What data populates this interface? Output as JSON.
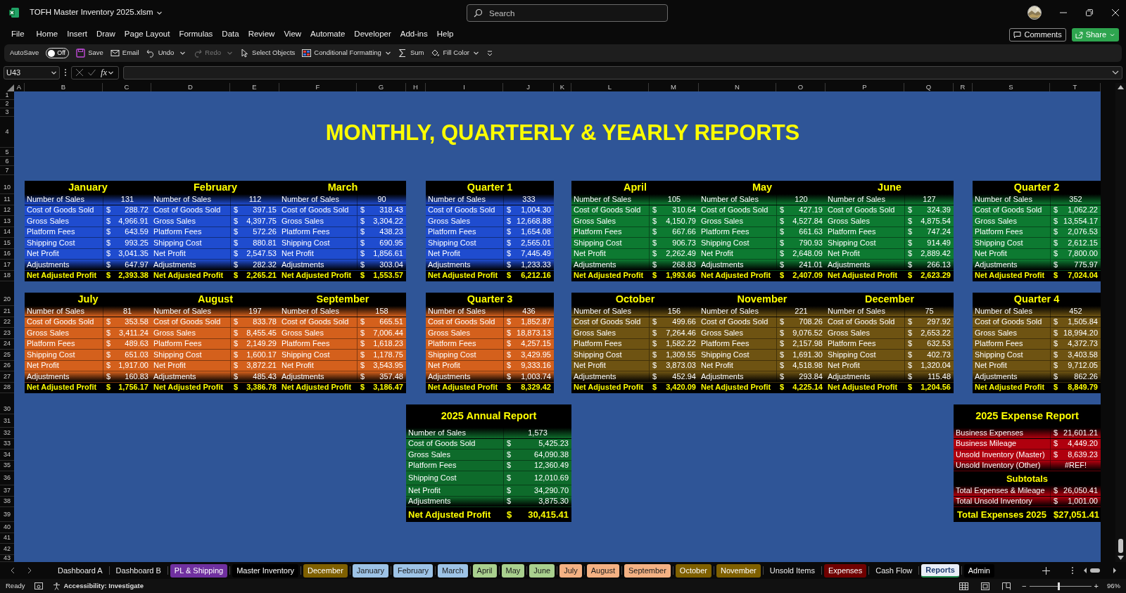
{
  "window": {
    "file_name": "TOFH Master Inventory 2025.xlsm"
  },
  "search": {
    "placeholder": "Search"
  },
  "menu": [
    "File",
    "Home",
    "Insert",
    "Draw",
    "Page Layout",
    "Formulas",
    "Data",
    "Review",
    "View",
    "Automate",
    "Developer",
    "Add-ins",
    "Help"
  ],
  "comments_button": "Comments",
  "share_button": "Share",
  "toolbar": {
    "autosave": {
      "label": "AutoSave",
      "state_text": "Off",
      "on": false
    },
    "buttons": [
      {
        "label": "Save",
        "disabled": false,
        "menu": false
      },
      {
        "label": "Email",
        "disabled": false,
        "menu": false
      },
      {
        "label": "Undo",
        "disabled": false,
        "menu": true
      },
      {
        "label": "Redo",
        "disabled": true,
        "menu": true
      },
      {
        "label": "Select Objects",
        "disabled": false,
        "menu": false
      },
      {
        "label": "Conditional Formatting",
        "disabled": false,
        "menu": true
      },
      {
        "label": "Sum",
        "disabled": false,
        "menu": false
      },
      {
        "label": "Fill Color",
        "disabled": false,
        "menu": true
      }
    ]
  },
  "formula_bar": {
    "name_box": "U43",
    "function_label": "fx"
  },
  "column_headers": [
    "A",
    "B",
    "C",
    "D",
    "E",
    "F",
    "G",
    "H",
    "I",
    "J",
    "K",
    "L",
    "M",
    "N",
    "O",
    "P",
    "Q",
    "R",
    "S",
    "T"
  ],
  "row_headers": [
    "1",
    "2",
    "3",
    "4",
    "5",
    "6",
    "7",
    "10",
    "11",
    "12",
    "13",
    "14",
    "15",
    "16",
    "17",
    "18",
    "20",
    "21",
    "22",
    "23",
    "24",
    "25",
    "26",
    "27",
    "28",
    "30",
    "31",
    "32",
    "33",
    "34",
    "35",
    "36",
    "37",
    "38",
    "39",
    "40",
    "41",
    "42",
    "43"
  ],
  "report_title": "MONTHLY, QUARTERLY & YEARLY REPORTS",
  "sections": [
    {
      "color": "#1f4ccf",
      "months": [
        {
          "name": "January",
          "rows": [
            {
              "label": "Number of Sales",
              "value": "131"
            },
            {
              "label": "Cost of Goods Sold",
              "unit": "$",
              "value": "288.72"
            },
            {
              "label": "Gross Sales",
              "unit": "$",
              "value": "4,966.91"
            },
            {
              "label": "Platform Fees",
              "unit": "$",
              "value": "643.59"
            },
            {
              "label": "Shipping Cost",
              "unit": "$",
              "value": "993.25"
            },
            {
              "label": "Net Profit",
              "unit": "$",
              "value": "3,041.35"
            },
            {
              "label": "Adjustments",
              "unit": "$",
              "value": "647.97"
            },
            {
              "label": "Net Adjusted Profit",
              "unit": "$",
              "value": "2,393.38"
            }
          ]
        },
        {
          "name": "February",
          "rows": [
            {
              "label": "Number of Sales",
              "value": "112"
            },
            {
              "label": "Cost of Goods Sold",
              "unit": "$",
              "value": "397.15"
            },
            {
              "label": "Gross Sales",
              "unit": "$",
              "value": "4,397.75"
            },
            {
              "label": "Platform Fees",
              "unit": "$",
              "value": "572.26"
            },
            {
              "label": "Shipping Cost",
              "unit": "$",
              "value": "880.81"
            },
            {
              "label": "Net Profit",
              "unit": "$",
              "value": "2,547.53"
            },
            {
              "label": "Adjustments",
              "unit": "$",
              "value": "282.32"
            },
            {
              "label": "Net Adjusted Profit",
              "unit": "$",
              "value": "2,265.21"
            }
          ]
        },
        {
          "name": "March",
          "rows": [
            {
              "label": "Number of Sales",
              "value": "90"
            },
            {
              "label": "Cost of Goods Sold",
              "unit": "$",
              "value": "318.43"
            },
            {
              "label": "Gross Sales",
              "unit": "$",
              "value": "3,304.22"
            },
            {
              "label": "Platform Fees",
              "unit": "$",
              "value": "438.23"
            },
            {
              "label": "Shipping Cost",
              "unit": "$",
              "value": "690.95"
            },
            {
              "label": "Net Profit",
              "unit": "$",
              "value": "1,856.61"
            },
            {
              "label": "Adjustments",
              "unit": "$",
              "value": "303.04"
            },
            {
              "label": "Net Adjusted Profit",
              "unit": "$",
              "value": "1,553.57"
            }
          ]
        }
      ],
      "quarter": {
        "name": "Quarter 1",
        "rows": [
          {
            "label": "Number of Sales",
            "value": "333"
          },
          {
            "label": "Cost of Goods Sold",
            "unit": "$",
            "value": "1,004.30"
          },
          {
            "label": "Gross Sales",
            "unit": "$",
            "value": "12,668.88"
          },
          {
            "label": "Platform Fees",
            "unit": "$",
            "value": "1,654.08"
          },
          {
            "label": "Shipping Cost",
            "unit": "$",
            "value": "2,565.01"
          },
          {
            "label": "Net Profit",
            "unit": "$",
            "value": "7,445.49"
          },
          {
            "label": "Adjustments",
            "unit": "$",
            "value": "1,233.33"
          },
          {
            "label": "Net Adjusted Profit",
            "unit": "$",
            "value": "6,212.16"
          }
        ]
      }
    },
    {
      "color": "#0d7a31",
      "months": [
        {
          "name": "April",
          "rows": [
            {
              "label": "Number of Sales",
              "value": "105"
            },
            {
              "label": "Cost of Goods Sold",
              "unit": "$",
              "value": "310.64"
            },
            {
              "label": "Gross Sales",
              "unit": "$",
              "value": "4,150.79"
            },
            {
              "label": "Platform Fees",
              "unit": "$",
              "value": "667.66"
            },
            {
              "label": "Shipping Cost",
              "unit": "$",
              "value": "906.73"
            },
            {
              "label": "Net Profit",
              "unit": "$",
              "value": "2,262.49"
            },
            {
              "label": "Adjustments",
              "unit": "$",
              "value": "268.83"
            },
            {
              "label": "Net Adjusted Profit",
              "unit": "$",
              "value": "1,993.66"
            }
          ]
        },
        {
          "name": "May",
          "rows": [
            {
              "label": "Number of Sales",
              "value": "120"
            },
            {
              "label": "Cost of Goods Sold",
              "unit": "$",
              "value": "427.19"
            },
            {
              "label": "Gross Sales",
              "unit": "$",
              "value": "4,527.84"
            },
            {
              "label": "Platform Fees",
              "unit": "$",
              "value": "661.63"
            },
            {
              "label": "Shipping Cost",
              "unit": "$",
              "value": "790.93"
            },
            {
              "label": "Net Profit",
              "unit": "$",
              "value": "2,648.09"
            },
            {
              "label": "Adjustments",
              "unit": "$",
              "value": "241.01"
            },
            {
              "label": "Net Adjusted Profit",
              "unit": "$",
              "value": "2,407.09"
            }
          ]
        },
        {
          "name": "June",
          "rows": [
            {
              "label": "Number of Sales",
              "value": "127"
            },
            {
              "label": "Cost of Goods Sold",
              "unit": "$",
              "value": "324.39"
            },
            {
              "label": "Gross Sales",
              "unit": "$",
              "value": "4,875.54"
            },
            {
              "label": "Platform Fees",
              "unit": "$",
              "value": "747.24"
            },
            {
              "label": "Shipping Cost",
              "unit": "$",
              "value": "914.49"
            },
            {
              "label": "Net Profit",
              "unit": "$",
              "value": "2,889.42"
            },
            {
              "label": "Adjustments",
              "unit": "$",
              "value": "266.13"
            },
            {
              "label": "Net Adjusted Profit",
              "unit": "$",
              "value": "2,623.29"
            }
          ]
        }
      ],
      "quarter": {
        "name": "Quarter 2",
        "rows": [
          {
            "label": "Number of Sales",
            "value": "352"
          },
          {
            "label": "Cost of Goods Sold",
            "unit": "$",
            "value": "1,062.22"
          },
          {
            "label": "Gross Sales",
            "unit": "$",
            "value": "13,554.17"
          },
          {
            "label": "Platform Fees",
            "unit": "$",
            "value": "2,076.53"
          },
          {
            "label": "Shipping Cost",
            "unit": "$",
            "value": "2,612.15"
          },
          {
            "label": "Net Profit",
            "unit": "$",
            "value": "7,800.00"
          },
          {
            "label": "Adjustments",
            "unit": "$",
            "value": "775.97"
          },
          {
            "label": "Net Adjusted Profit",
            "unit": "$",
            "value": "7,024.04"
          }
        ]
      }
    },
    {
      "color": "#d4601c",
      "months": [
        {
          "name": "July",
          "rows": [
            {
              "label": "Number of Sales",
              "value": "81"
            },
            {
              "label": "Cost of Goods Sold",
              "unit": "$",
              "value": "353.58"
            },
            {
              "label": "Gross Sales",
              "unit": "$",
              "value": "3,411.24"
            },
            {
              "label": "Platform Fees",
              "unit": "$",
              "value": "489.63"
            },
            {
              "label": "Shipping Cost",
              "unit": "$",
              "value": "651.03"
            },
            {
              "label": "Net Profit",
              "unit": "$",
              "value": "1,917.00"
            },
            {
              "label": "Adjustments",
              "unit": "$",
              "value": "160.83"
            },
            {
              "label": "Net Adjusted Profit",
              "unit": "$",
              "value": "1,756.17"
            }
          ]
        },
        {
          "name": "August",
          "rows": [
            {
              "label": "Number of Sales",
              "value": "197"
            },
            {
              "label": "Cost of Goods Sold",
              "unit": "$",
              "value": "833.78"
            },
            {
              "label": "Gross Sales",
              "unit": "$",
              "value": "8,455.45"
            },
            {
              "label": "Platform Fees",
              "unit": "$",
              "value": "2,149.29"
            },
            {
              "label": "Shipping Cost",
              "unit": "$",
              "value": "1,600.17"
            },
            {
              "label": "Net Profit",
              "unit": "$",
              "value": "3,872.21"
            },
            {
              "label": "Adjustments",
              "unit": "$",
              "value": "485.43"
            },
            {
              "label": "Net Adjusted Profit",
              "unit": "$",
              "value": "3,386.78"
            }
          ]
        },
        {
          "name": "September",
          "rows": [
            {
              "label": "Number of Sales",
              "value": "158"
            },
            {
              "label": "Cost of Goods Sold",
              "unit": "$",
              "value": "665.51"
            },
            {
              "label": "Gross Sales",
              "unit": "$",
              "value": "7,006.44"
            },
            {
              "label": "Platform Fees",
              "unit": "$",
              "value": "1,618.23"
            },
            {
              "label": "Shipping Cost",
              "unit": "$",
              "value": "1,178.75"
            },
            {
              "label": "Net Profit",
              "unit": "$",
              "value": "3,543.95"
            },
            {
              "label": "Adjustments",
              "unit": "$",
              "value": "357.48"
            },
            {
              "label": "Net Adjusted Profit",
              "unit": "$",
              "value": "3,186.47"
            }
          ]
        }
      ],
      "quarter": {
        "name": "Quarter 3",
        "rows": [
          {
            "label": "Number of Sales",
            "value": "436"
          },
          {
            "label": "Cost of Goods Sold",
            "unit": "$",
            "value": "1,852.87"
          },
          {
            "label": "Gross Sales",
            "unit": "$",
            "value": "18,873.13"
          },
          {
            "label": "Platform Fees",
            "unit": "$",
            "value": "4,257.15"
          },
          {
            "label": "Shipping Cost",
            "unit": "$",
            "value": "3,429.95"
          },
          {
            "label": "Net Profit",
            "unit": "$",
            "value": "9,333.16"
          },
          {
            "label": "Adjustments",
            "unit": "$",
            "value": "1,003.74"
          },
          {
            "label": "Net Adjusted Profit",
            "unit": "$",
            "value": "8,329.42"
          }
        ]
      }
    },
    {
      "color": "#6e5312",
      "months": [
        {
          "name": "October",
          "rows": [
            {
              "label": "Number of Sales",
              "value": "156"
            },
            {
              "label": "Cost of Goods Sold",
              "unit": "$",
              "value": "499.66"
            },
            {
              "label": "Gross Sales",
              "unit": "$",
              "value": "7,264.46"
            },
            {
              "label": "Platform Fees",
              "unit": "$",
              "value": "1,582.22"
            },
            {
              "label": "Shipping Cost",
              "unit": "$",
              "value": "1,309.55"
            },
            {
              "label": "Net Profit",
              "unit": "$",
              "value": "3,873.03"
            },
            {
              "label": "Adjustments",
              "unit": "$",
              "value": "452.94"
            },
            {
              "label": "Net Adjusted Profit",
              "unit": "$",
              "value": "3,420.09"
            }
          ]
        },
        {
          "name": "November",
          "rows": [
            {
              "label": "Number of Sales",
              "value": "221"
            },
            {
              "label": "Cost of Goods Sold",
              "unit": "$",
              "value": "708.26"
            },
            {
              "label": "Gross Sales",
              "unit": "$",
              "value": "9,076.52"
            },
            {
              "label": "Platform Fees",
              "unit": "$",
              "value": "2,157.98"
            },
            {
              "label": "Shipping Cost",
              "unit": "$",
              "value": "1,691.30"
            },
            {
              "label": "Net Profit",
              "unit": "$",
              "value": "4,518.98"
            },
            {
              "label": "Adjustments",
              "unit": "$",
              "value": "293.84"
            },
            {
              "label": "Net Adjusted Profit",
              "unit": "$",
              "value": "4,225.14"
            }
          ]
        },
        {
          "name": "December",
          "rows": [
            {
              "label": "Number of Sales",
              "value": "75"
            },
            {
              "label": "Cost of Goods Sold",
              "unit": "$",
              "value": "297.92"
            },
            {
              "label": "Gross Sales",
              "unit": "$",
              "value": "2,653.22"
            },
            {
              "label": "Platform Fees",
              "unit": "$",
              "value": "632.53"
            },
            {
              "label": "Shipping Cost",
              "unit": "$",
              "value": "402.73"
            },
            {
              "label": "Net Profit",
              "unit": "$",
              "value": "1,320.04"
            },
            {
              "label": "Adjustments",
              "unit": "$",
              "value": "115.48"
            },
            {
              "label": "Net Adjusted Profit",
              "unit": "$",
              "value": "1,204.56"
            }
          ]
        }
      ],
      "quarter": {
        "name": "Quarter 4",
        "rows": [
          {
            "label": "Number of Sales",
            "value": "452"
          },
          {
            "label": "Cost of Goods Sold",
            "unit": "$",
            "value": "1,505.84"
          },
          {
            "label": "Gross Sales",
            "unit": "$",
            "value": "18,994.20"
          },
          {
            "label": "Platform Fees",
            "unit": "$",
            "value": "4,372.73"
          },
          {
            "label": "Shipping Cost",
            "unit": "$",
            "value": "3,403.58"
          },
          {
            "label": "Net Profit",
            "unit": "$",
            "value": "9,712.05"
          },
          {
            "label": "Adjustments",
            "unit": "$",
            "value": "862.26"
          },
          {
            "label": "Net Adjusted Profit",
            "unit": "$",
            "value": "8,849.79"
          }
        ]
      }
    }
  ],
  "annual_report": {
    "title": "2025 Annual Report",
    "color": "#0e6b2b",
    "rows": [
      {
        "kind": "item",
        "label": "Number of Sales",
        "value": "1,573"
      },
      {
        "kind": "item",
        "label": "Cost of Goods Sold",
        "unit": "$",
        "value": "5,425.23"
      },
      {
        "kind": "item",
        "label": "Gross Sales",
        "unit": "$",
        "value": "64,090.38"
      },
      {
        "kind": "item",
        "label": "Platform Fees",
        "unit": "$",
        "value": "12,360.49"
      },
      {
        "kind": "item",
        "label": "Shipping Cost",
        "unit": "$",
        "value": "12,010.69"
      },
      {
        "kind": "item",
        "label": "Net Profit",
        "unit": "$",
        "value": "34,290.70"
      },
      {
        "kind": "item",
        "label": "Adjustments",
        "unit": "$",
        "value": "3,875.30"
      },
      {
        "kind": "total",
        "label": "Net Adjusted Profit",
        "unit": "$",
        "value": "30,415.41"
      }
    ]
  },
  "expense_report": {
    "title": "2025 Expense Report",
    "color": "#b0000e",
    "rows": [
      {
        "kind": "item",
        "label": "Business Expenses",
        "unit": "$",
        "value": "21,601.21"
      },
      {
        "kind": "item",
        "label": "Business Mileage",
        "unit": "$",
        "value": "4,449.20"
      },
      {
        "kind": "item",
        "label": "Unsold Inventory (Master)",
        "unit": "$",
        "value": "8,639.23"
      },
      {
        "kind": "item",
        "label": "Unsold Inventory (Other)",
        "value": "#REF!"
      },
      {
        "kind": "heading",
        "label": "Subtotals"
      },
      {
        "kind": "item",
        "label": "Total Expenses & Mileage",
        "unit": "$",
        "value": "26,050.41"
      },
      {
        "kind": "item",
        "label": "Total Unsold Inventory",
        "unit": "$",
        "value": "1,001.00"
      },
      {
        "kind": "total",
        "label": "Total Expenses 2025",
        "unit": "$",
        "value": "27,051.41"
      }
    ]
  },
  "sheet_tabs": [
    {
      "label": "Dashboard A",
      "selected": false
    },
    {
      "label": "Dashboard B",
      "selected": false
    },
    {
      "label": "PL & Shipping",
      "color": "#7030a0",
      "selected": false
    },
    {
      "label": "Master Inventory",
      "color": "#000000",
      "selected": false
    },
    {
      "label": "December",
      "color": "#7f6000",
      "selected": false
    },
    {
      "label": "January",
      "color": "#9dc3e6",
      "selected": false
    },
    {
      "label": "February",
      "color": "#9dc3e6",
      "selected": false
    },
    {
      "label": "March",
      "color": "#9dc3e6",
      "selected": false
    },
    {
      "label": "April",
      "color": "#a9d08e",
      "selected": false
    },
    {
      "label": "May",
      "color": "#a9d08e",
      "selected": false
    },
    {
      "label": "June",
      "color": "#a9d08e",
      "selected": false
    },
    {
      "label": "July",
      "color": "#f4b183",
      "selected": false
    },
    {
      "label": "August",
      "color": "#f4b183",
      "selected": false
    },
    {
      "label": "September",
      "color": "#f4b183",
      "selected": false
    },
    {
      "label": "October",
      "color": "#7f6000",
      "selected": false
    },
    {
      "label": "November",
      "color": "#7f6000",
      "selected": false
    },
    {
      "label": "Unsold Items",
      "selected": false
    },
    {
      "label": "Expenses",
      "color": "#700000",
      "selected": false
    },
    {
      "label": "Cash Flow",
      "selected": false
    },
    {
      "label": "Reports",
      "selected": true
    },
    {
      "label": "Admin",
      "color": "#000000",
      "selected": false
    }
  ],
  "status_bar": {
    "state": "Ready",
    "accessibility": "Accessibility: Investigate",
    "zoom_out": "−",
    "zoom_in": "+",
    "zoom_slider": {
      "level": 0.48
    },
    "zoom": "96%"
  }
}
